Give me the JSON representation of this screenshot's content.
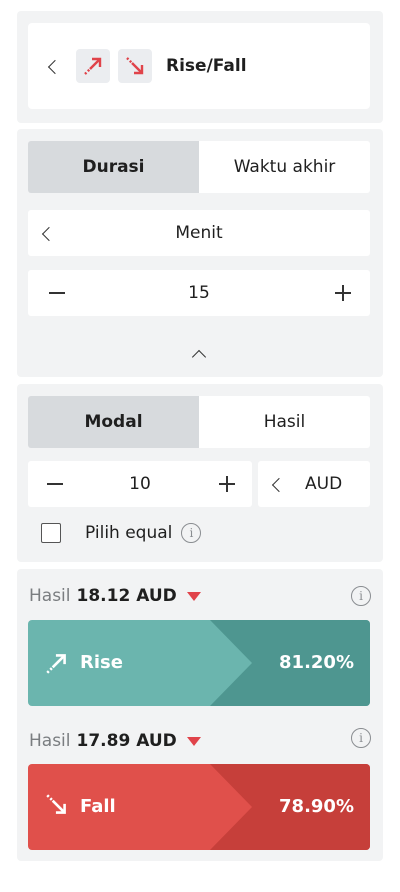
{
  "header": {
    "title": "Rise/Fall"
  },
  "duration": {
    "tabs": [
      "Durasi",
      "Waktu akhir"
    ],
    "unit": "Menit",
    "value": "15"
  },
  "stake": {
    "tabs": [
      "Modal",
      "Hasil"
    ],
    "amount": "10",
    "currency": "AUD",
    "equal_label": "Pilih equal"
  },
  "contracts": [
    {
      "payout_prefix": "Hasil",
      "payout": "18.12 AUD",
      "label": "Rise",
      "percent": "81.20%",
      "color_main": "#6bb5ae",
      "color_dark": "#4e9690"
    },
    {
      "payout_prefix": "Hasil",
      "payout": "17.89 AUD",
      "label": "Fall",
      "percent": "78.90%",
      "color_main": "#e0504b",
      "color_dark": "#c63f3a"
    }
  ],
  "colors": {
    "accent_red": "#e0434a",
    "panel_bg": "#f2f3f4"
  }
}
